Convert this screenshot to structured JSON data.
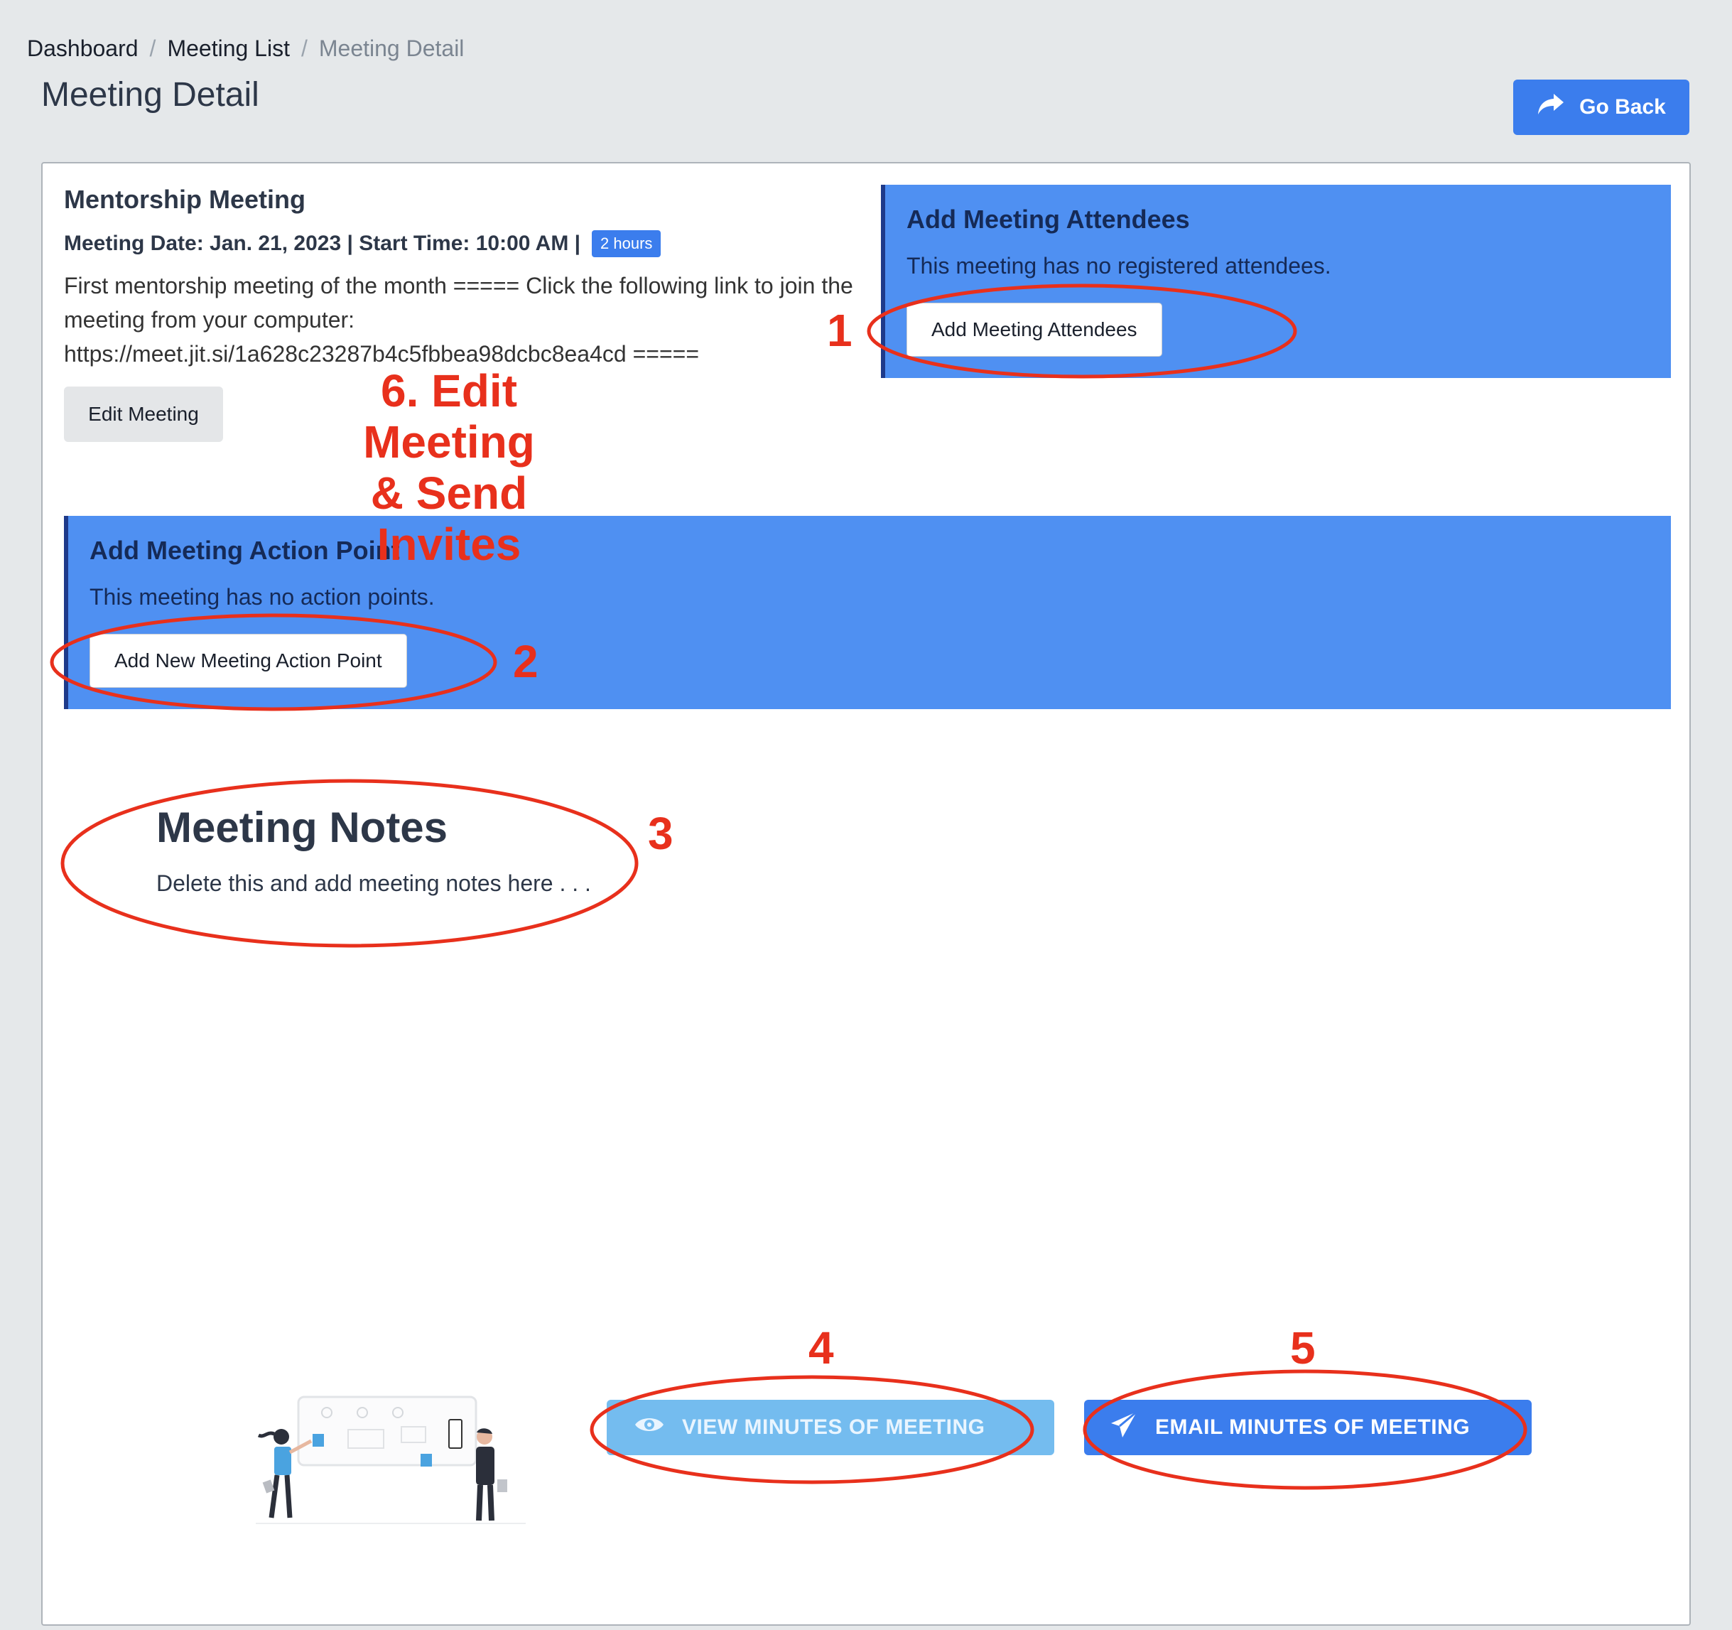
{
  "breadcrumb": {
    "items": [
      "Dashboard",
      "Meeting List",
      "Meeting Detail"
    ],
    "separator": "/"
  },
  "page": {
    "title": "Meeting Detail",
    "go_back_label": "Go Back",
    "go_back_icon": "share-arrow-icon"
  },
  "meeting": {
    "title": "Mentorship Meeting",
    "meta": "Meeting Date: Jan. 21, 2023 | Start Time: 10:00 AM |",
    "duration_badge": "2 hours",
    "description": "First mentorship meeting of the month ===== Click the following link to join the meeting from your computer: https://meet.jit.si/1a628c23287b4c5fbbea98dcbc8ea4cd =====",
    "edit_label": "Edit Meeting"
  },
  "attendees_panel": {
    "title": "Add Meeting Attendees",
    "text": "This meeting has no registered attendees.",
    "button_label": "Add Meeting Attendees"
  },
  "action_panel": {
    "title": "Add Meeting Action Point",
    "text": "This meeting has no action points.",
    "button_label": "Add New Meeting Action Point"
  },
  "notes": {
    "title": "Meeting Notes",
    "body": "Delete this and add meeting notes here . . ."
  },
  "actions": {
    "view_label": "VIEW MINUTES OF MEETING",
    "view_icon": "eye-icon",
    "email_label": "EMAIL MINUTES OF MEETING",
    "email_icon": "paper-plane-icon"
  },
  "annotations": {
    "n1": "1",
    "n2": "2",
    "n3": "3",
    "n4": "4",
    "n5": "5",
    "n6_line1": "6. Edit Meeting",
    "n6_line2": "& Send Invites",
    "color": "#e8301c"
  },
  "colors": {
    "primary": "#3b7ded",
    "panel": "#4f90f2",
    "panel_text": "#152a57",
    "view_button": "#74bcef",
    "background": "#e5e8ea"
  }
}
